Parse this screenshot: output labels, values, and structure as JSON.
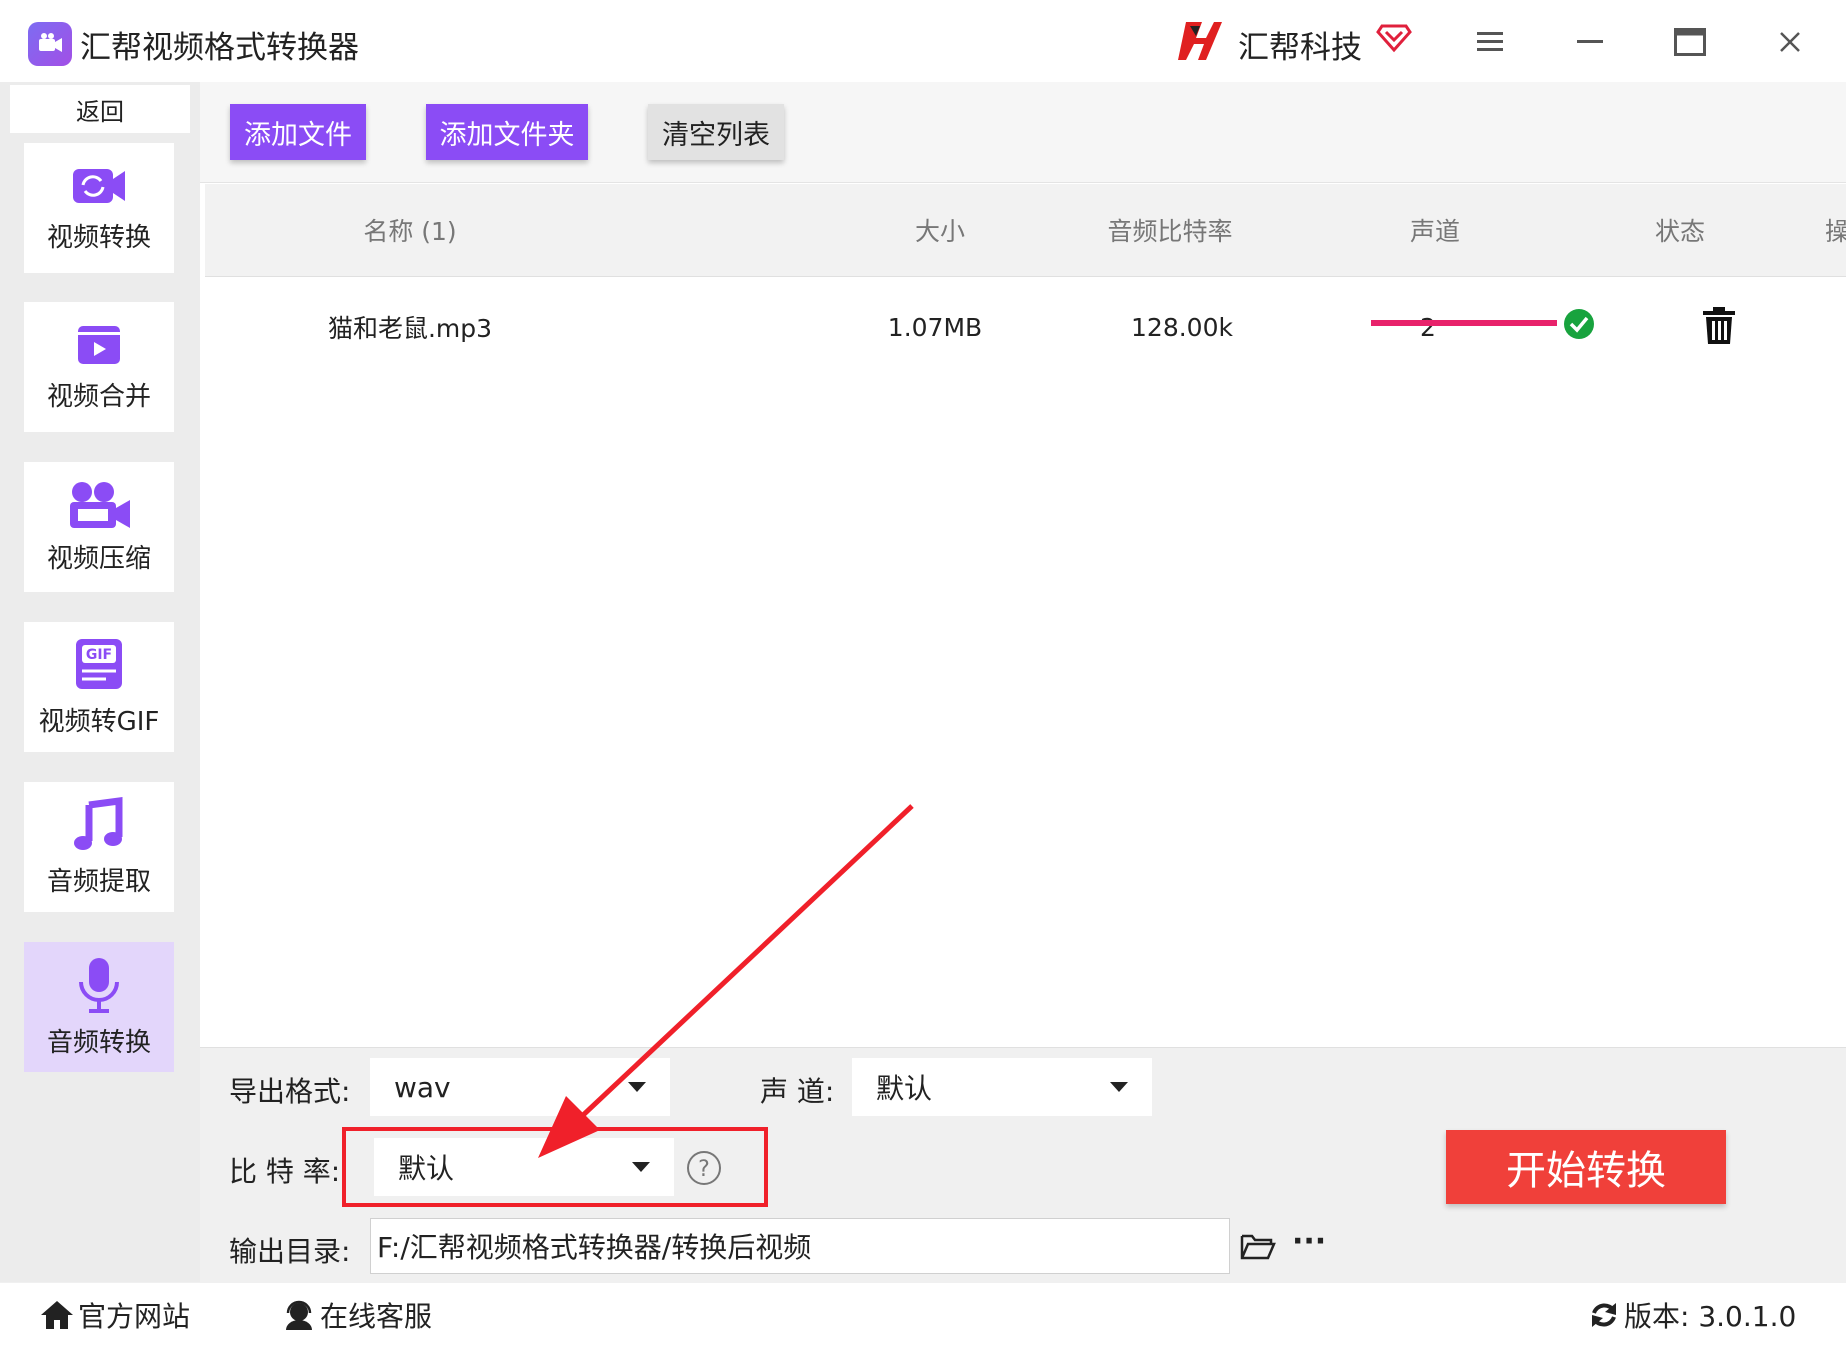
{
  "app": {
    "title": "汇帮视频格式转换器",
    "brand": "汇帮科技"
  },
  "colors": {
    "accent": "#8b4cf5",
    "start": "#f0403a",
    "progress": "#e8226b",
    "success": "#18a33e"
  },
  "sidebar": {
    "back": "返回",
    "items": [
      {
        "label": "视频转换",
        "icon": "video-convert-icon"
      },
      {
        "label": "视频合并",
        "icon": "video-merge-icon"
      },
      {
        "label": "视频压缩",
        "icon": "video-compress-icon"
      },
      {
        "label": "视频转GIF",
        "icon": "gif-icon"
      },
      {
        "label": "音频提取",
        "icon": "music-note-icon"
      },
      {
        "label": "音频转换",
        "icon": "microphone-icon",
        "active": true
      }
    ]
  },
  "toolbar": {
    "add_file": "添加文件",
    "add_folder": "添加文件夹",
    "clear_list": "清空列表"
  },
  "table": {
    "headers": [
      "名称 (1)",
      "大小",
      "音频比特率",
      "声道",
      "状态",
      "操作"
    ],
    "rows": [
      {
        "name": "猫和老鼠.mp3",
        "size": "1.07MB",
        "bitrate": "128.00k",
        "channels": "2",
        "progress": 1.0
      }
    ]
  },
  "settings": {
    "format_label": "导出格式:",
    "format_value": "wav",
    "channel_label": "声 道:",
    "channel_value": "默认",
    "bitrate_label": "比 特 率:",
    "bitrate_value": "默认",
    "output_label": "输出目录:",
    "output_path": "F:/汇帮视频格式转换器/转换后视频",
    "more": "···"
  },
  "start_button": "开始转换",
  "footer": {
    "website": "官方网站",
    "support": "在线客服",
    "version": "版本: 3.0.1.0"
  }
}
